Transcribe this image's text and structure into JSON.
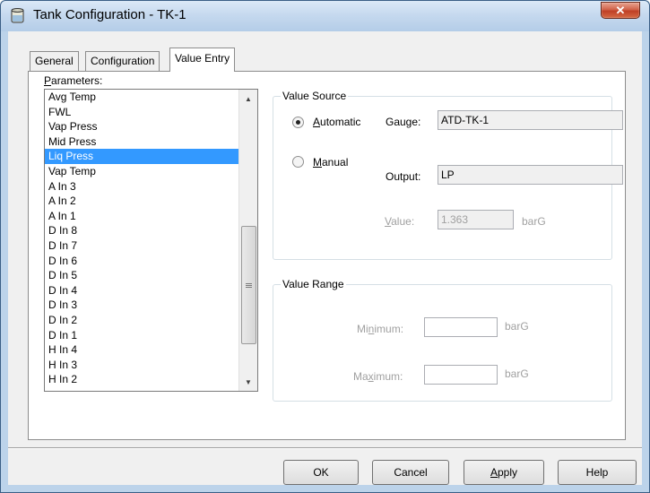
{
  "window": {
    "title": "Tank Configuration - TK-1",
    "close_icon": "close-x-icon"
  },
  "tabs": [
    {
      "label": "General",
      "active": false
    },
    {
      "label": "Configuration",
      "active": false
    },
    {
      "label": "Value Entry",
      "active": true
    }
  ],
  "parameters": {
    "label_prefix": "",
    "label_underlined": "P",
    "label_rest": "arameters:",
    "items": [
      "Avg Temp",
      "FWL",
      "Vap Press",
      "Mid Press",
      "Liq Press",
      "Vap Temp",
      "A In 3",
      "A In 2",
      "A In 1",
      "D In 8",
      "D In 7",
      "D In 6",
      "D In 5",
      "D In 4",
      "D In 3",
      "D In 2",
      "D In 1",
      "H In 4",
      "H In 3",
      "H In 2"
    ],
    "selected": "Liq Press"
  },
  "value_source": {
    "title": "Value Source",
    "automatic_underlined": "A",
    "automatic_rest": "utomatic",
    "manual_underlined": "M",
    "manual_rest": "anual",
    "selected": "Automatic",
    "gauge_label": "Gauge:",
    "gauge_value": "ATD-TK-1",
    "output_label": "Output:",
    "output_value": "LP",
    "value_label_underlined": "V",
    "value_label_rest": "alue:",
    "value_value": "1.363",
    "value_unit": "barG"
  },
  "value_range": {
    "title": "Value Range",
    "minimum_pre": "Mi",
    "minimum_underlined": "n",
    "minimum_post": "imum:",
    "minimum_value": "",
    "minimum_unit": "barG",
    "maximum_pre": "Ma",
    "maximum_underlined": "x",
    "maximum_post": "imum:",
    "maximum_value": "",
    "maximum_unit": "barG"
  },
  "buttons": {
    "ok": "OK",
    "cancel": "Cancel",
    "apply_underlined": "A",
    "apply_rest": "pply",
    "help": "Help"
  }
}
